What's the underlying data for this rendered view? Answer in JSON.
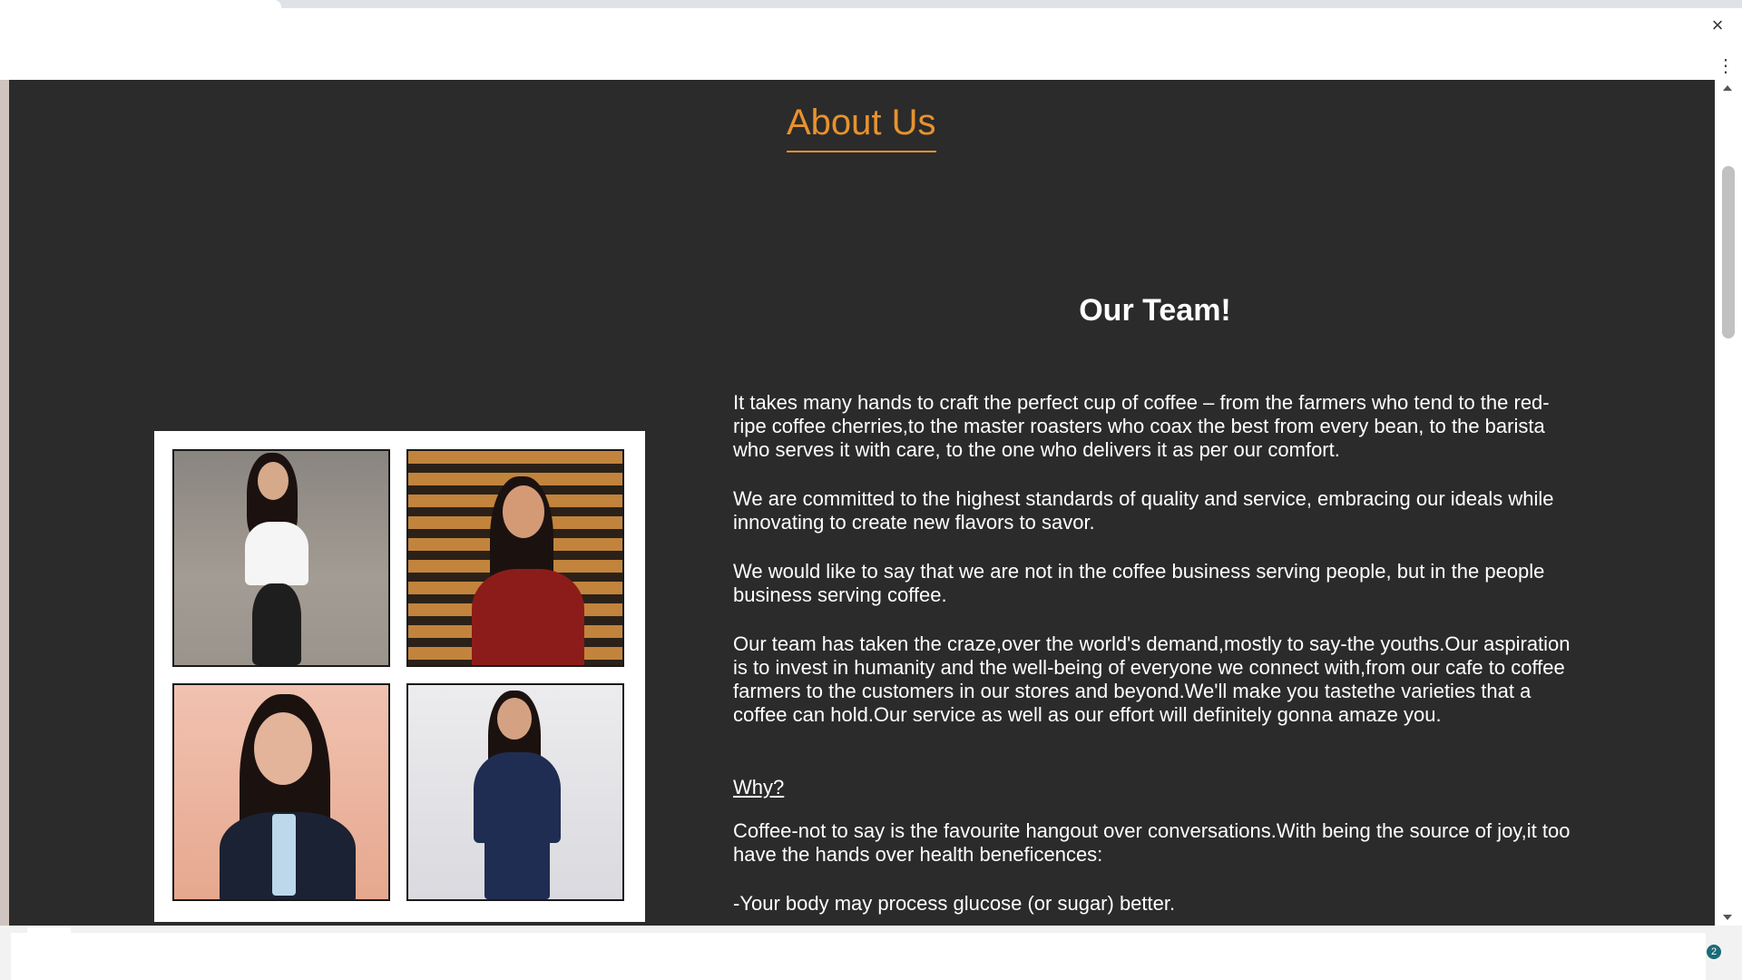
{
  "browser": {
    "close_icon": "×",
    "menu_icon": "⋮",
    "notification_count": "2"
  },
  "page": {
    "heading": "About Us",
    "heading_color": "#e8922e",
    "background_color": "#2b2b2b"
  },
  "team": {
    "title": "Our Team!",
    "paragraphs": [
      "It takes many hands to craft the perfect cup of coffee – from the farmers who tend to the red-ripe coffee cherries,to the master roasters who coax the best from every bean, to the barista who serves it with care, to the one who delivers it as per our comfort.",
      "We are committed to the highest standards of quality and service, embracing our ideals while innovating to create new flavors to savor.",
      "We would like to say that we are not in the coffee business serving people, but in the people business serving coffee.",
      "Our team has taken the craze,over the world's demand,mostly to say-the youths.Our aspiration is to invest in humanity and the well-being of everyone we connect with,from our cafe to coffee farmers to the customers in our stores and beyond.We'll make you tastethe varieties that a coffee can hold.Our service as well as our effort will definitely gonna amaze you."
    ],
    "why_label": "Why?",
    "why_text": "Coffee-not to say is the favourite hangout over conversations.With being the source of joy,it too have the hands over health beneficences:",
    "benefit_1": "-Your body may process glucose (or sugar) better."
  }
}
